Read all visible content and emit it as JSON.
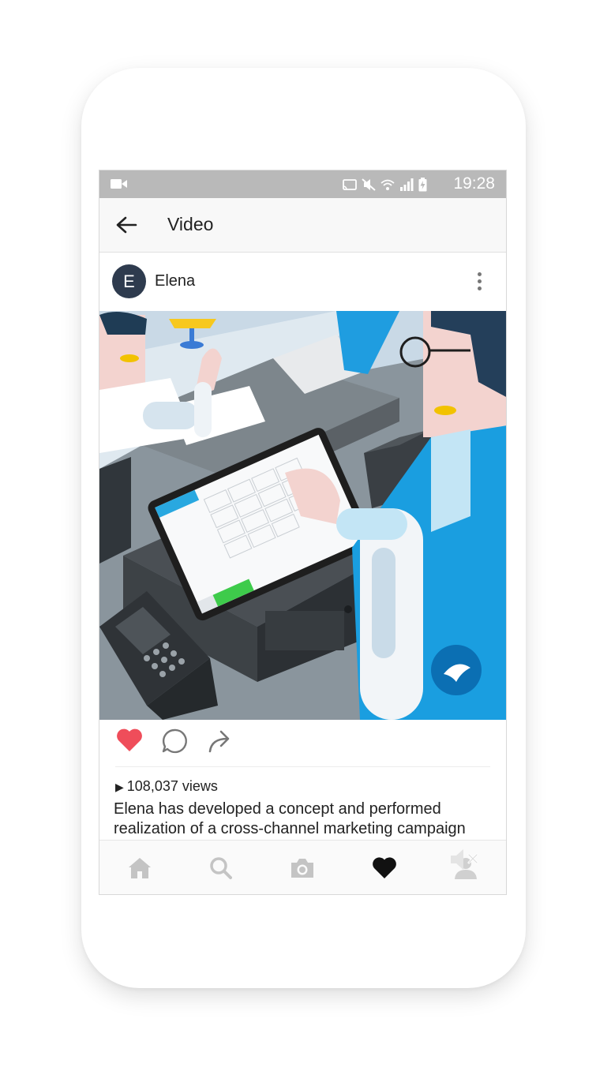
{
  "status_bar": {
    "time": "19:28"
  },
  "app_bar": {
    "title": "Video"
  },
  "post": {
    "avatar_letter": "E",
    "username": "Elena",
    "views": "108,037 views",
    "caption": "Elena has developed a concept and performed realization of a cross-channel marketing campaign"
  },
  "icons": {
    "back": "arrow-left-icon",
    "more": "more-vertical-icon",
    "like": "heart-icon",
    "comment": "comment-icon",
    "share": "share-icon",
    "mute": "mute-icon"
  },
  "bottom_nav": {
    "items": [
      "home-icon",
      "search-icon",
      "camera-icon",
      "heart-icon",
      "profile-icon"
    ]
  },
  "colors": {
    "like": "#ef4d5a",
    "avatar": "#2e3b4e",
    "status_bar": "#b9b9b9"
  }
}
